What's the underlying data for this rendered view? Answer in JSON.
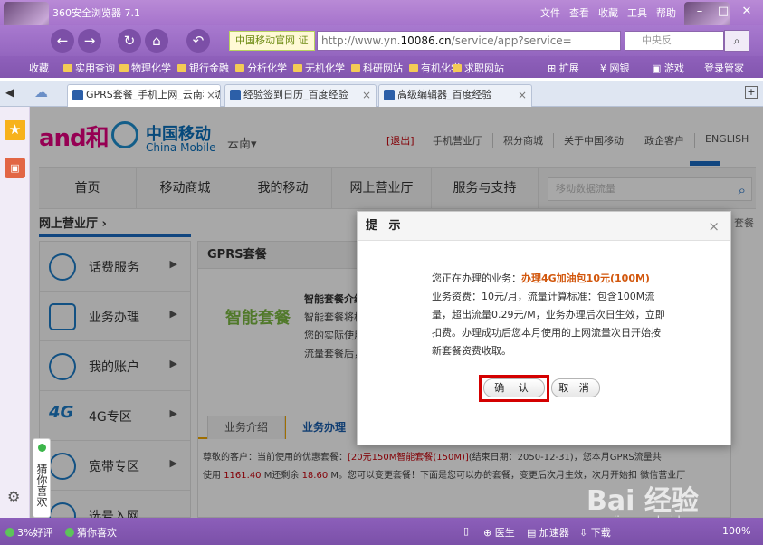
{
  "browser": {
    "app_title": "360安全浏览器 7.1",
    "menus": [
      "文件",
      "查看",
      "收藏",
      "工具",
      "帮助"
    ],
    "site_badge": "中国移动官网 证",
    "url_prefix": "http://www.yn.",
    "url_host": "10086.cn",
    "url_suffix": "/service/app?service=",
    "search_placeholder": "中央反",
    "bookmarks": [
      "收藏",
      "实用查询",
      "物理化学",
      "银行金融",
      "分析化学",
      "无机化学",
      "科研网站",
      "有机化学",
      "求职网站",
      "扩展",
      "网银",
      "游戏",
      "登录管家"
    ],
    "tabs": [
      {
        "label": "GPRS套餐_手机上网_云南移动",
        "active": true
      },
      {
        "label": "经验签到日历_百度经验",
        "active": false
      },
      {
        "label": "高级编辑器_百度经验",
        "active": false
      }
    ],
    "side_guess": "猜你喜欢",
    "status": {
      "rating": "3%好评",
      "guess": "猜你喜欢",
      "doctor": "医生",
      "accelerator": "加速器",
      "download": "下载",
      "zoom": "100%"
    }
  },
  "site": {
    "brand_andhe": "and和",
    "brand_cn": "中国移动",
    "brand_en": "China Mobile",
    "region": "云南▾",
    "logout": "[退出]",
    "top_links": [
      "手机营业厅",
      "积分商城",
      "关于中国移动",
      "政企客户",
      "ENGLISH"
    ],
    "nav_items": [
      "首页",
      "移动商城",
      "我的移动",
      "网上营业厅",
      "服务与支持"
    ],
    "nav_search_placeholder": "移动数据流量",
    "breadcrumb": "网上营业厅 ›",
    "breadcrumb_right": "套餐",
    "left_menu": [
      "话费服务",
      "业务办理",
      "我的账户",
      "4G专区",
      "宽带专区",
      "选号入网"
    ],
    "content_header": "GPRS套餐",
    "smart_logo": "智能套餐",
    "intro_lines": [
      "智能套餐介绍",
      "智能套餐将根",
      "您的实际使用",
      "流量套餐后，"
    ],
    "tabs": [
      "业务介绍",
      "业务办理"
    ],
    "notice_line1_pre": "尊敬的客户：当前使用的优惠套餐：",
    "notice_plan": "[20元150M智能套餐(150M)]",
    "notice_line1_mid": "(结束日期：",
    "notice_enddate": "2050-12-31",
    "notice_line1_post": ")，您本月GPRS流量共",
    "notice_line2_pre": "使用",
    "notice_used": "1161.40",
    "notice_line2_mid": "M还剩余",
    "notice_left": "18.60",
    "notice_line2_post": "M。您可以变更套餐！下面是您可以办的套餐，变更后次月生效，次月开始扣",
    "notice_wechat": "微信营业厅"
  },
  "modal": {
    "title": "提 示",
    "close": "×",
    "line1_pre": "您正在办理的业务：",
    "line1_highlight": "办理4G加油包10元(100M)",
    "body_rest": "业务资费：10元/月，流量计算标准：包含100M流量，超出流量0.29元/M，业务办理后次日生效，立即扣费。办理成功后您本月使用的上网流量次日开始按新套餐资费收取。",
    "confirm_label": "确 认",
    "cancel_label": "取 消"
  },
  "watermark": {
    "text": "Bai 经验",
    "sub": "jingyan.baidu.com"
  }
}
